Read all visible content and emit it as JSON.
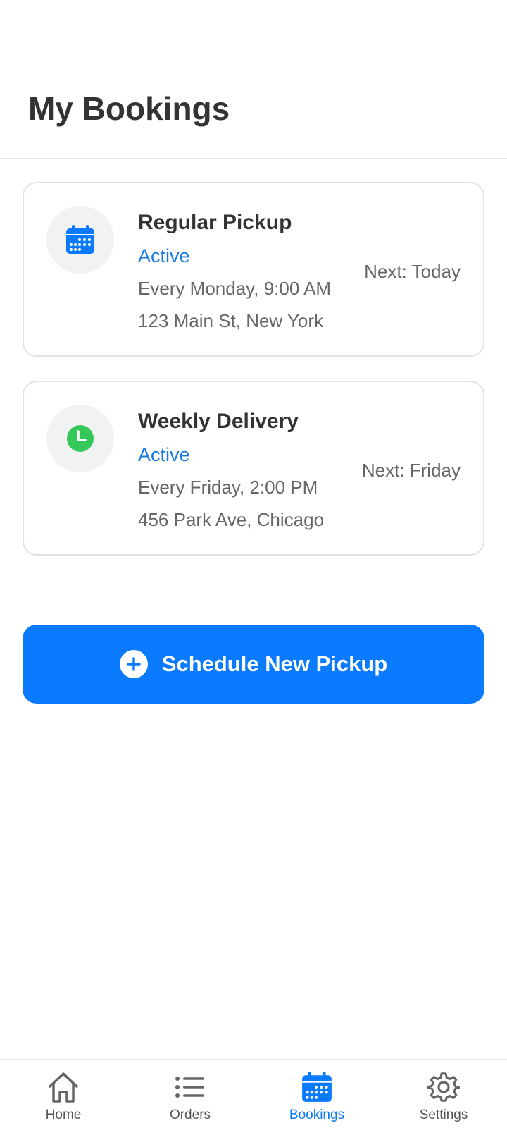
{
  "header": {
    "title": "My Bookings"
  },
  "bookings": [
    {
      "icon": "calendar-icon",
      "title": "Regular Pickup",
      "status": "Active",
      "schedule": "Every Monday, 9:00 AM",
      "address": "123 Main St, New York",
      "next": "Next: Today"
    },
    {
      "icon": "clock-icon",
      "title": "Weekly Delivery",
      "status": "Active",
      "schedule": "Every Friday, 2:00 PM",
      "address": "456 Park Ave, Chicago",
      "next": "Next: Friday"
    }
  ],
  "actions": {
    "schedule_label": "Schedule New Pickup"
  },
  "tabs": [
    {
      "label": "Home",
      "icon": "home-icon"
    },
    {
      "label": "Orders",
      "icon": "list-icon"
    },
    {
      "label": "Bookings",
      "icon": "calendar-icon",
      "active": true
    },
    {
      "label": "Settings",
      "icon": "gear-icon"
    }
  ],
  "colors": {
    "accent": "#0a7aff",
    "status_active": "#1a7be0",
    "clock_green": "#34c759"
  }
}
